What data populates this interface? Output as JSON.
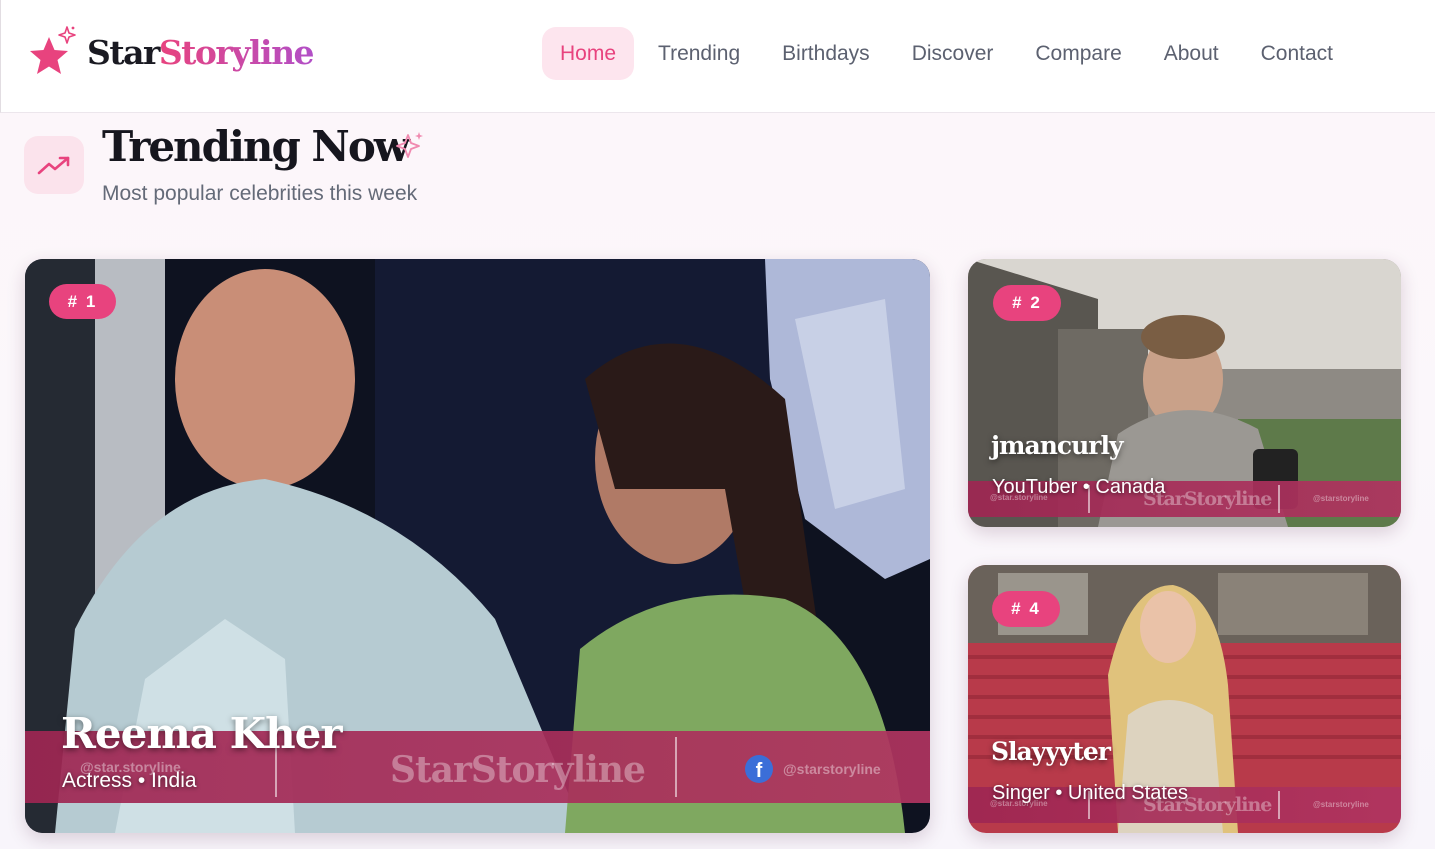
{
  "brand": {
    "name_part1": "Star",
    "name_part2": "Storyline"
  },
  "nav": {
    "items": [
      {
        "label": "Home",
        "active": true
      },
      {
        "label": "Trending",
        "active": false
      },
      {
        "label": "Birthdays",
        "active": false
      },
      {
        "label": "Discover",
        "active": false
      },
      {
        "label": "Compare",
        "active": false
      },
      {
        "label": "About",
        "active": false
      },
      {
        "label": "Contact",
        "active": false
      }
    ]
  },
  "section": {
    "icon": "trending-up-icon",
    "title": "Trending Now",
    "subtitle": "Most popular celebrities this week"
  },
  "watermark": {
    "brand": "StarStoryline",
    "instagram_handle": "@star.storyline",
    "facebook_handle": "@starstoryline"
  },
  "cards": [
    {
      "rank": "# 1",
      "name": "Reema Kher",
      "profession": "Actress",
      "country": "India",
      "meta": "Actress • India"
    },
    {
      "rank": "# 2",
      "name": "jmancurly",
      "profession": "YouTuber",
      "country": "Canada",
      "meta": "YouTuber • Canada"
    },
    {
      "rank": "# 4",
      "name": "Slayyyter",
      "profession": "Singer",
      "country": "United States",
      "meta": "Singer • United States"
    }
  ],
  "colors": {
    "accent": "#e8437e",
    "accent_soft": "#fde5ee",
    "brand_gradient_end": "#b24fc7",
    "text_dark": "#16161e",
    "text_muted": "#646a78",
    "watermark_band": "#9e2652"
  }
}
